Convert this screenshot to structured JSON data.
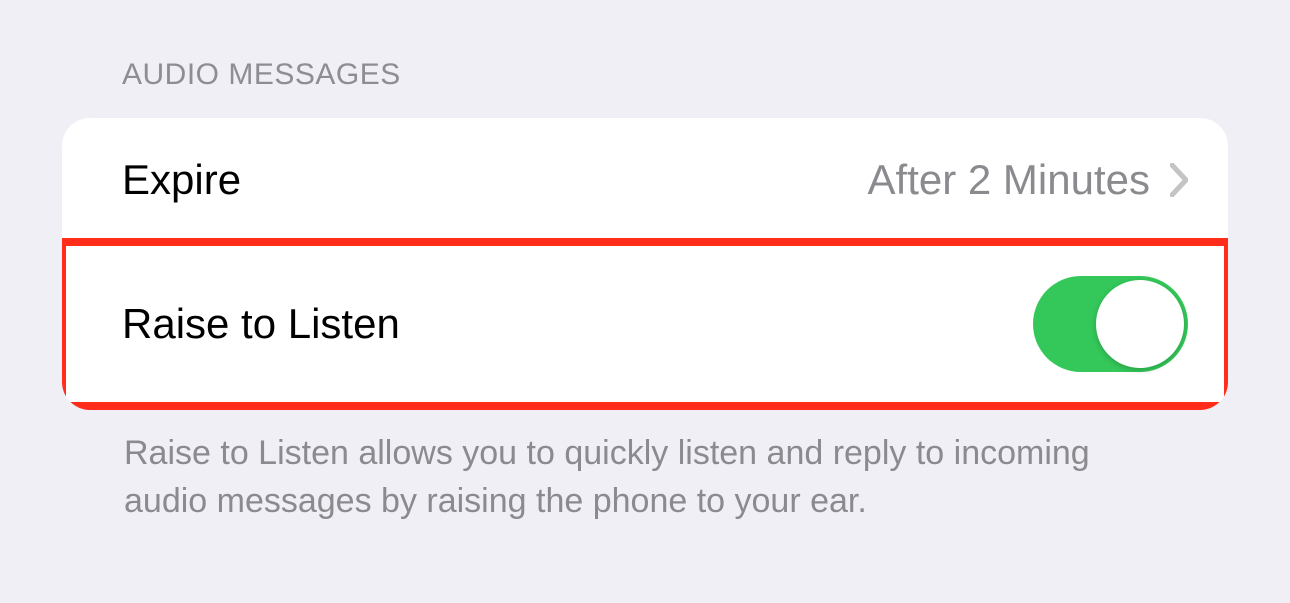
{
  "section": {
    "header": "AUDIO MESSAGES",
    "footer": "Raise to Listen allows you to quickly listen and reply to incoming audio messages by raising the phone to your ear."
  },
  "rows": {
    "expire": {
      "label": "Expire",
      "value": "After 2 Minutes"
    },
    "raiseToListen": {
      "label": "Raise to Listen",
      "enabled": true
    }
  }
}
